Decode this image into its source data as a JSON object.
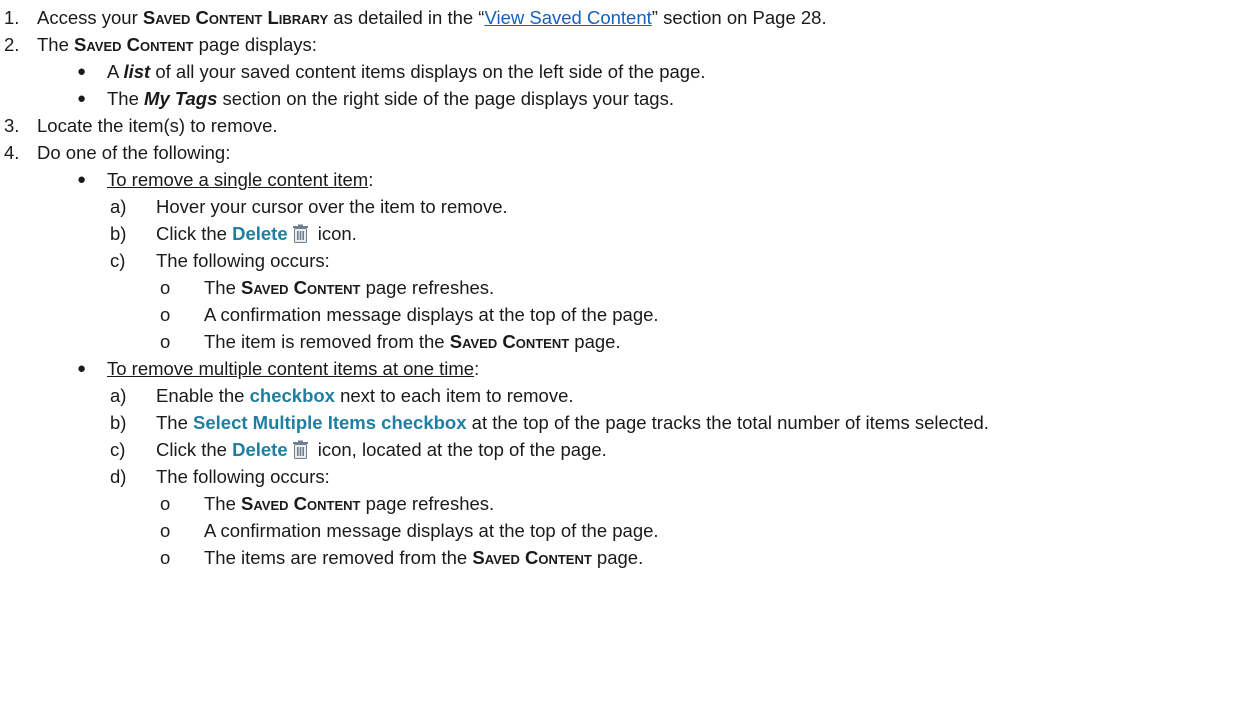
{
  "steps": {
    "s1": {
      "num": "1.",
      "a": "Access your ",
      "b": "Saved Content Library",
      "c": " as detailed in the “",
      "link": "View Saved Content",
      "d": "” section on Page 28."
    },
    "s2": {
      "num": "2.",
      "a": "The ",
      "b": "Saved Content",
      "c": " page displays:",
      "bullet1": {
        "a": "A ",
        "b": "list",
        "c": " of all your saved content items displays on the left side of the page."
      },
      "bullet2": {
        "a": "The ",
        "b": "My Tags",
        "c": " section on the right side of the page displays your tags."
      }
    },
    "s3": {
      "num": "3.",
      "text": "Locate the item(s) to remove."
    },
    "s4": {
      "num": "4.",
      "text": "Do one of the following:",
      "single": {
        "heading": "To remove a single content item",
        "colon": ":",
        "a": {
          "label": "a)",
          "text": "Hover your cursor over the item to remove."
        },
        "b": {
          "label": "b)",
          "pre": "Click the ",
          "accent": "Delete",
          "post": " icon."
        },
        "c": {
          "label": "c)",
          "text": "The following occurs:"
        },
        "o1": {
          "a": "The ",
          "b": "Saved Content",
          "c": " page refreshes."
        },
        "o2": {
          "text": "A confirmation message displays at the top of the page."
        },
        "o3": {
          "a": "The item is removed from the ",
          "b": "Saved Content",
          "c": " page."
        }
      },
      "multiple": {
        "heading": "To remove multiple content items at one time",
        "colon": ":",
        "a": {
          "label": "a)",
          "pre": "Enable the ",
          "accent": "checkbox",
          "post": " next to each item to remove."
        },
        "b": {
          "label": "b)",
          "pre": "The ",
          "accent": "Select Multiple Items checkbox",
          "post": " at the top of the page tracks the total number of items selected."
        },
        "c": {
          "label": "c)",
          "pre": "Click the ",
          "accent": "Delete",
          "post": " icon, located at the top of the page."
        },
        "d": {
          "label": "d)",
          "text": "The following occurs:"
        },
        "o1": {
          "a": "The ",
          "b": "Saved Content",
          "c": " page refreshes."
        },
        "o2": {
          "text": "A confirmation message displays at the top of the page."
        },
        "o3": {
          "a": "The items are removed from the ",
          "b": "Saved Content",
          "c": " page."
        }
      }
    }
  },
  "glyphs": {
    "bullet": "●",
    "o_bullet": "o"
  },
  "colors": {
    "accent": "#1f7fa0",
    "link": "#1560bd",
    "text": "#1a1a1a"
  },
  "icons": {
    "delete": "trash-icon"
  }
}
